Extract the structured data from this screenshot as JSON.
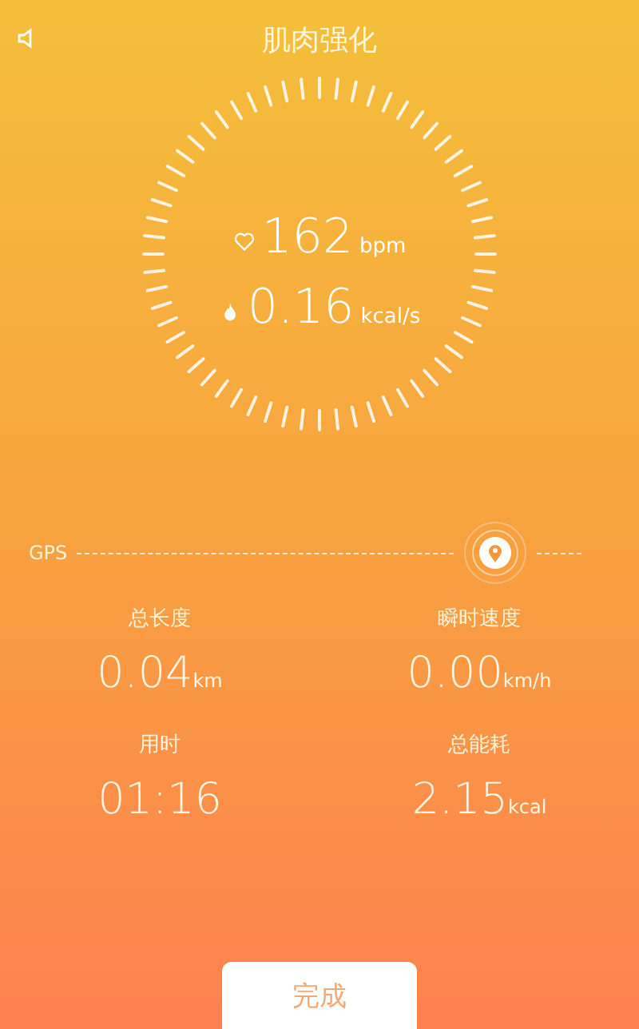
{
  "header": {
    "title": "肌肉强化"
  },
  "dial": {
    "heart_rate": {
      "value": "162",
      "unit": "bpm"
    },
    "burn_rate": {
      "value": "0.16",
      "unit": "kcal/s"
    }
  },
  "gps": {
    "label": "GPS"
  },
  "stats": [
    {
      "label": "总长度",
      "value": "0.04",
      "unit": "km"
    },
    {
      "label": "瞬时速度",
      "value": "0.00",
      "unit": "km/h"
    },
    {
      "label": "用时",
      "value": "01:16"
    },
    {
      "label": "总能耗",
      "value": "2.15",
      "unit": "kcal"
    }
  ],
  "button": {
    "label": "完成"
  }
}
